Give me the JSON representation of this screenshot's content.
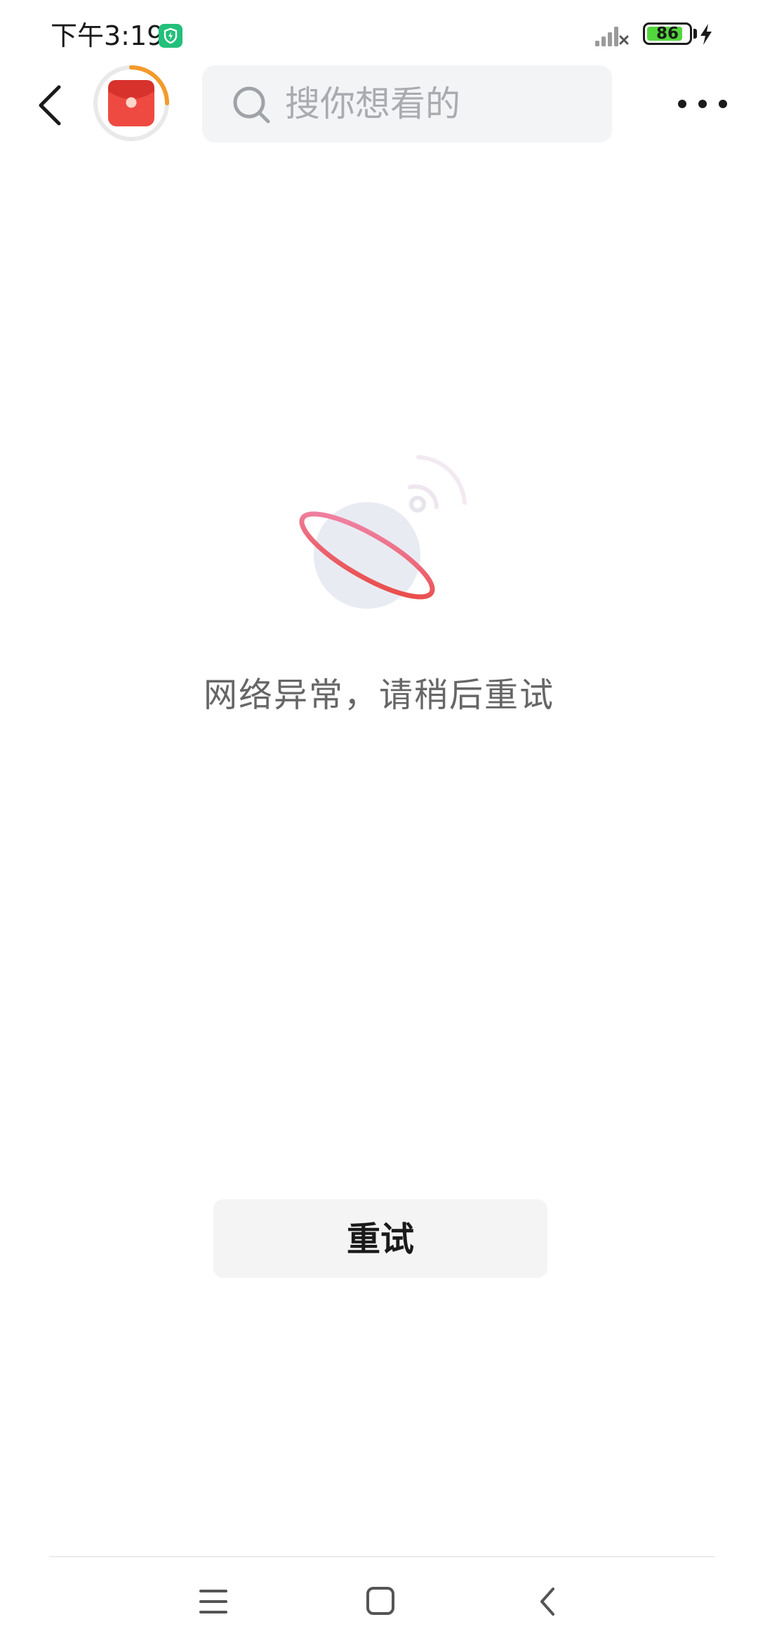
{
  "status_bar": {
    "time": "下午3:19",
    "battery_level": "86",
    "battery_fraction": 0.86,
    "icons": [
      "shield-icon",
      "signal-icon",
      "battery-icon",
      "charging-bolt-icon"
    ]
  },
  "header": {
    "back_icon": "chevron-left-icon",
    "logo_icon": "red-envelope-logo-icon",
    "search": {
      "placeholder": "搜你想看的",
      "icon": "search-icon"
    },
    "more_icon": "more-dots-icon"
  },
  "main": {
    "illustration_icon": "planet-signal-icon",
    "error_message": "网络异常，请稍后重试",
    "retry_label": "重试"
  },
  "colors": {
    "accent_red": "#e8453c",
    "accent_orange": "#f39a2b",
    "badge_green": "#22c07a",
    "battery_green": "#53d63c"
  },
  "nav_bar": {
    "icons": [
      "menu-lines-icon",
      "home-square-icon",
      "back-chevron-icon"
    ]
  }
}
